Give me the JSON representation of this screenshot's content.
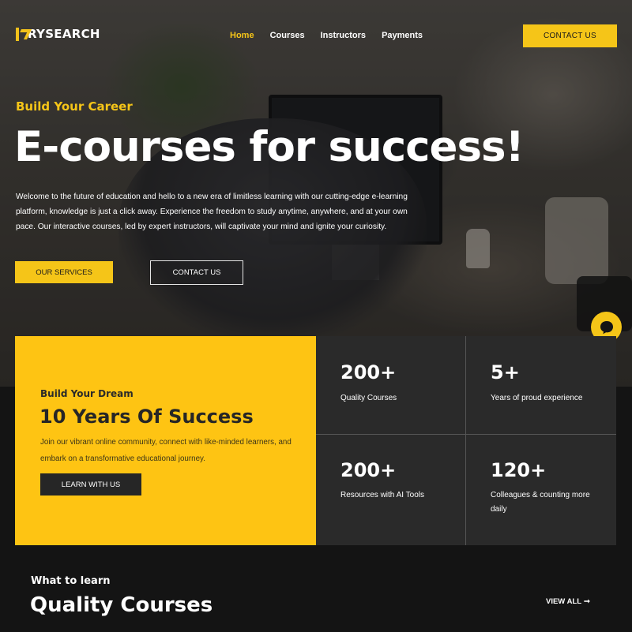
{
  "brand": {
    "logo_text": "RYSEARCH"
  },
  "nav": {
    "items": [
      {
        "label": "Home",
        "active": true
      },
      {
        "label": "Courses"
      },
      {
        "label": "Instructors"
      },
      {
        "label": "Payments"
      }
    ],
    "cta": "CONTACT US"
  },
  "hero": {
    "eyebrow": "Build Your Career",
    "title": "E-courses for success!",
    "text": "Welcome to the future of education and hello to a new era of limitless learning with our cutting-edge e-learning platform, knowledge is just a click away. Experience the freedom to study anytime, anywhere, and at your own pace. Our interactive courses, led by expert instructors, will captivate your mind and ignite your curiosity.",
    "primary_button": "OUR SERVICES",
    "secondary_button": "CONTACT US"
  },
  "dream": {
    "eyebrow": "Build Your Dream",
    "title": "10 Years Of Success",
    "text": "Join our vibrant online community, connect with like-minded learners, and embark on a transformative educational journey.",
    "button": "LEARN WITH US"
  },
  "stats": [
    {
      "value": "200+",
      "label": "Quality Courses"
    },
    {
      "value": "5+",
      "label": "Years of proud experience"
    },
    {
      "value": "200+",
      "label": "Resources with AI Tools"
    },
    {
      "value": "120+",
      "label": "Colleagues & counting more daily"
    }
  ],
  "courses": {
    "eyebrow": "What to learn",
    "title": "Quality Courses",
    "view_all": "VIEW ALL",
    "view_all_arrow": "➞"
  },
  "colors": {
    "accent": "#f5c518",
    "dark": "#141414",
    "panel": "#2a2a2a"
  },
  "icons": {
    "chat": "chat-bubble-icon",
    "arrow": "arrow-right-icon"
  }
}
